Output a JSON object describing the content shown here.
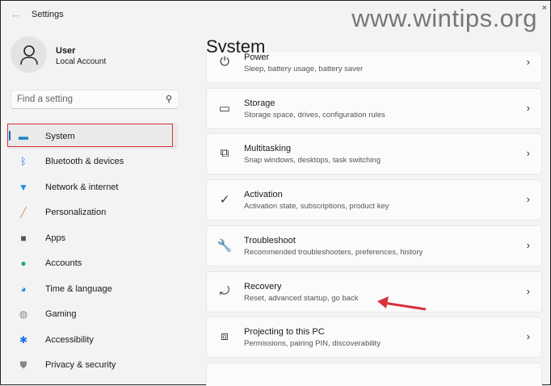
{
  "window": {
    "title": "Settings",
    "back_icon": "back-arrow-icon",
    "minimize": "–",
    "maximize": "▢",
    "close": "×"
  },
  "watermark": "www.wintips.org",
  "user": {
    "name": "User",
    "account": "Local Account"
  },
  "search": {
    "placeholder": "Find a setting"
  },
  "sidebar": {
    "items": [
      {
        "label": "System",
        "icon": "display-icon",
        "color": "#1f86c9"
      },
      {
        "label": "Bluetooth & devices",
        "icon": "bluetooth-icon",
        "color": "#1a73e8"
      },
      {
        "label": "Network & internet",
        "icon": "wifi-icon",
        "color": "#1a8fe0"
      },
      {
        "label": "Personalization",
        "icon": "brush-icon",
        "color": "#e8873a"
      },
      {
        "label": "Apps",
        "icon": "apps-icon",
        "color": "#555"
      },
      {
        "label": "Accounts",
        "icon": "person-icon",
        "color": "#2aa58c"
      },
      {
        "label": "Time & language",
        "icon": "globe-clock-icon",
        "color": "#1a8fe0"
      },
      {
        "label": "Gaming",
        "icon": "gamepad-icon",
        "color": "#888"
      },
      {
        "label": "Accessibility",
        "icon": "accessibility-icon",
        "color": "#1a73e8"
      },
      {
        "label": "Privacy & security",
        "icon": "shield-icon",
        "color": "#888"
      }
    ]
  },
  "main": {
    "title": "System",
    "cards": [
      {
        "title": "Power",
        "subtitle": "Sleep, battery usage, battery saver",
        "icon": "⏻"
      },
      {
        "title": "Storage",
        "subtitle": "Storage space, drives, configuration rules",
        "icon": "▭"
      },
      {
        "title": "Multitasking",
        "subtitle": "Snap windows, desktops, task switching",
        "icon": "⧉"
      },
      {
        "title": "Activation",
        "subtitle": "Activation state, subscriptions, product key",
        "icon": "✓"
      },
      {
        "title": "Troubleshoot",
        "subtitle": "Recommended troubleshooters, preferences, history",
        "icon": "🔧"
      },
      {
        "title": "Recovery",
        "subtitle": "Reset, advanced startup, go back",
        "icon": "⤾"
      },
      {
        "title": "Projecting to this PC",
        "subtitle": "Permissions, pairing PIN, discoverability",
        "icon": "⧈"
      }
    ]
  },
  "chevron": "›"
}
